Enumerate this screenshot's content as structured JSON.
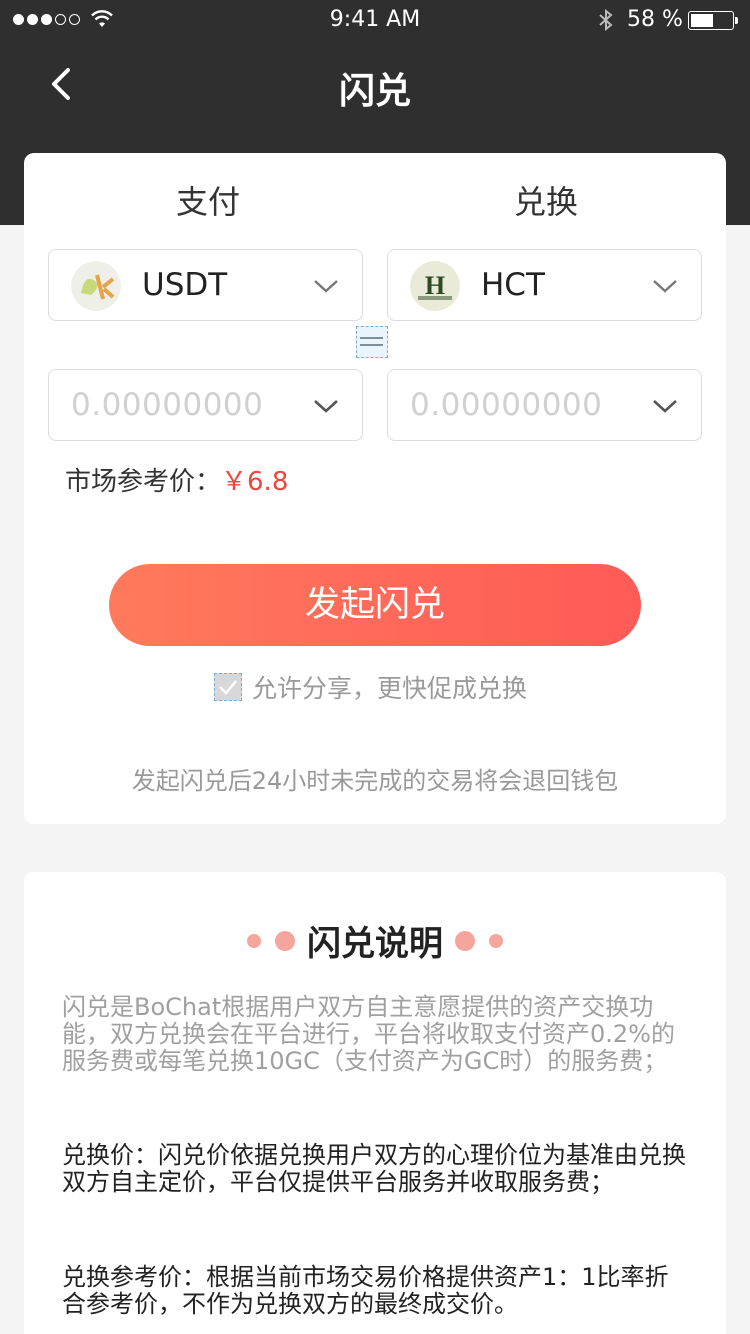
{
  "status_bar": {
    "time": "9:41 AM",
    "battery_percent": "58 %",
    "battery_level": 0.58,
    "signal_bars_filled": 3,
    "signal_bars_total": 5
  },
  "nav": {
    "title": "闪兑",
    "back_icon": "chevron-left-icon"
  },
  "exchange": {
    "pay_label": "支付",
    "receive_label": "兑换",
    "pay_coin": "USDT",
    "receive_coin": "HCT",
    "pay_amount_placeholder": "0.00000000",
    "receive_amount_placeholder": "0.00000000",
    "market_ref_label": "市场参考价：",
    "market_ref_price": "￥6.8",
    "launch_button": "发起闪兑",
    "share_checkbox_label": "允许分享，更快促成兑换",
    "notice": "发起闪兑后24小时未完成的交易将会退回钱包"
  },
  "info": {
    "title": "闪兑说明",
    "paragraph_1": "闪兑是BoChat根据用户双方自主意愿提供的资产交换功能，双方兑换会在平台进行，平台将收取支付资产0.2%的服务费或每笔兑换10GC（支付资产为GC时）的服务费；",
    "paragraph_2": "兑换价：闪兑价依据兑换用户双方的心理价位为基准由兑换双方自主定价，平台仅提供平台服务并收取服务费；",
    "paragraph_3": "兑换参考价：根据当前市场交易价格提供资产1：1比率折合参考价，不作为兑换双方的最终成交价。"
  },
  "colors": {
    "header_bg": "#2f2f2f",
    "accent_red": "#f0463c",
    "button_gradient_start": "#ff7a5c",
    "button_gradient_end": "#ff5a57",
    "decor_dot": "#f4a59c"
  }
}
